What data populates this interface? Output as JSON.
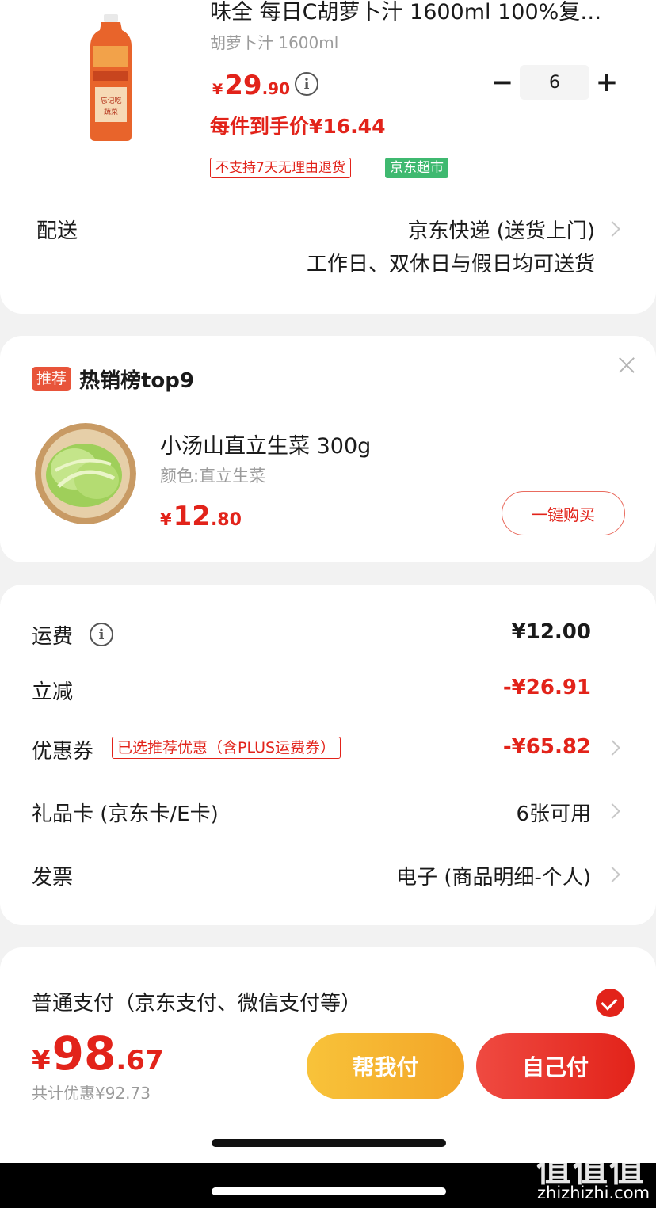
{
  "product": {
    "title": "味全 每日C胡萝卜汁 1600ml 100%复…",
    "spec": "胡萝卜汁 1600ml",
    "price_symbol": "¥",
    "price_int": "29",
    "price_dec": ".90",
    "unit_price": "每件到手价¥16.44",
    "qty_minus": "−",
    "quantity": "6",
    "qty_plus": "+",
    "tag_no_return": "不支持7天无理由退货",
    "tag_store": "京东超市",
    "bottle_label_1": "忘记吃",
    "bottle_label_2": "蔬菜"
  },
  "delivery": {
    "label": "配送",
    "method": "京东快递 (送货上门)",
    "schedule": "工作日、双休日与假日均可送货"
  },
  "recommend": {
    "badge": "推荐",
    "title": "热销榜top9",
    "item_name": "小汤山直立生菜 300g",
    "item_spec": "颜色:直立生菜",
    "price_symbol": "¥",
    "price_int": "12",
    "price_dec": ".80",
    "buy_label": "一键购买"
  },
  "fees": {
    "shipping_label": "运费",
    "shipping_value": "¥12.00",
    "discount_label": "立减",
    "discount_value": "-¥26.91",
    "coupon_label": "优惠券",
    "coupon_tag": "已选推荐优惠（含PLUS运费券）",
    "coupon_value": "-¥65.82",
    "giftcard_label": "礼品卡 (京东卡/E卡)",
    "giftcard_value": "6张可用",
    "invoice_label": "发票",
    "invoice_value": "电子 (商品明细-个人)"
  },
  "payment": {
    "method": "普通支付（京东支付、微信支付等）",
    "total_symbol": "¥",
    "total_int": "98",
    "total_dec": ".67",
    "saved": "共计优惠¥92.73",
    "help_pay": "帮我付",
    "self_pay": "自己付"
  },
  "watermark": {
    "logo": "值值值",
    "url": "zhizhizhi.com"
  },
  "colors": {
    "accent_red": "#e2231a",
    "store_green": "#3fb970",
    "help_yellow": "#f8c33a"
  }
}
